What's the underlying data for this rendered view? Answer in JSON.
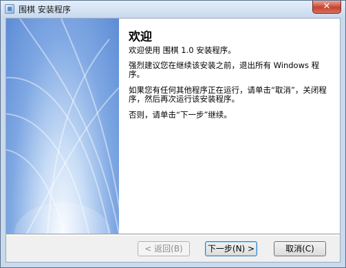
{
  "window": {
    "title": "围棋 安装程序",
    "close_glyph": "✕"
  },
  "content": {
    "heading": "欢迎",
    "paragraphs": [
      "欢迎使用 围棋 1.0 安装程序。",
      "强烈建议您在继续该安装之前，退出所有 Windows 程序。",
      "如果您有任何其他程序正在运行，请单击“取消”，关闭程序，然后再次运行该安装程序。",
      "否则，请单击“下一步”继续。"
    ]
  },
  "buttons": {
    "back": "< 返回(B)",
    "next": "下一步(N) >",
    "cancel": "取消(C)"
  },
  "colors": {
    "side_image_blue": "#5d8cd6",
    "title_bar": "#c7d9ee",
    "close_button": "#c7432d"
  }
}
